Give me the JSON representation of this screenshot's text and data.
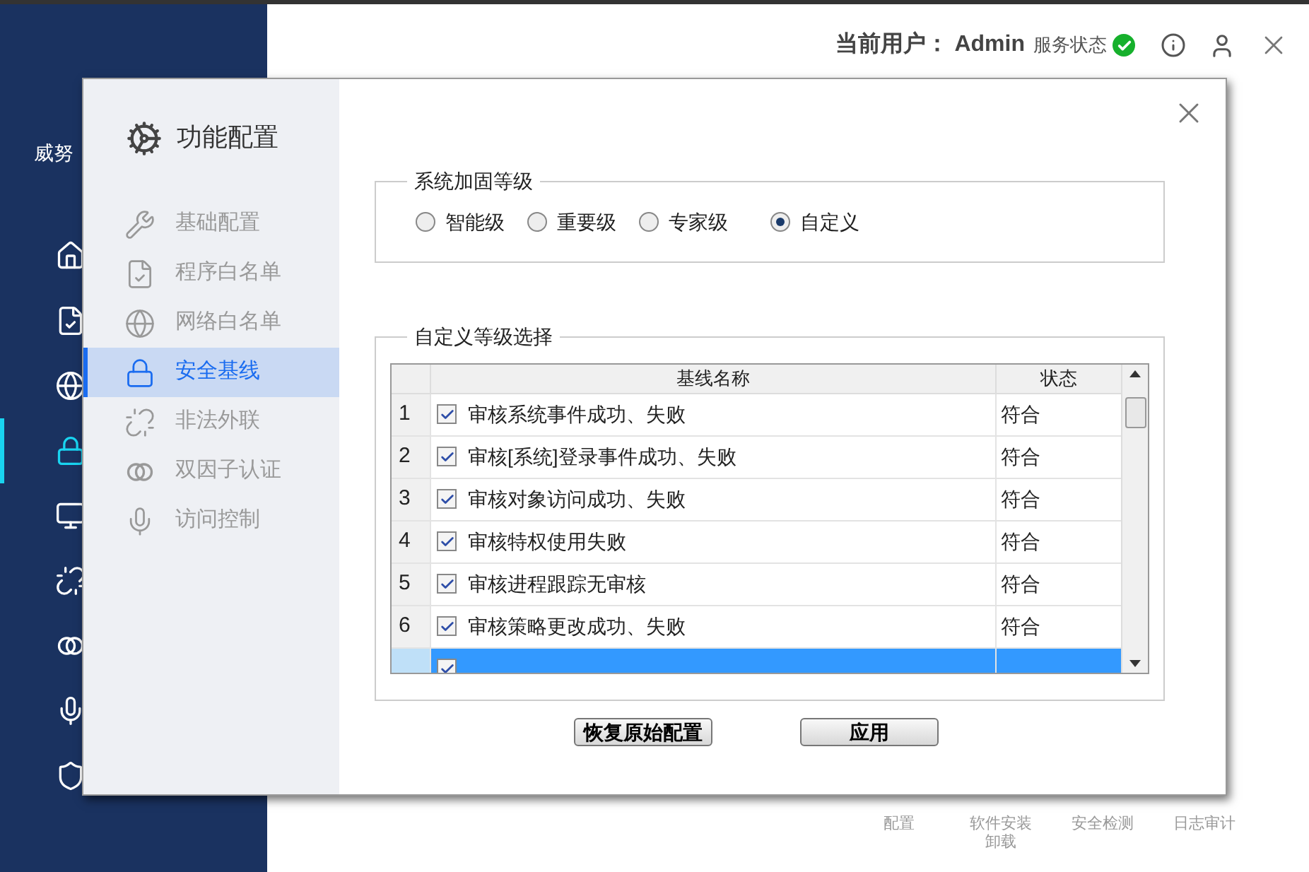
{
  "app": {
    "brand": "威努",
    "sidebar": [
      {
        "selected": false
      },
      {
        "selected": false
      },
      {
        "selected": false
      },
      {
        "selected": true
      },
      {
        "selected": false
      },
      {
        "selected": false
      },
      {
        "selected": false
      },
      {
        "selected": false
      },
      {
        "selected": false
      }
    ],
    "header": {
      "user_label": "当前用户：",
      "user": "Admin",
      "service_label": "服务状态",
      "service_ok": true
    },
    "bottom_tools": [
      [
        "配置"
      ],
      [
        "软件安装",
        "卸载"
      ],
      [
        "安全检测"
      ],
      [
        "日志审计"
      ]
    ]
  },
  "dialog": {
    "title": "功能配置",
    "nav": [
      {
        "label": "基础配置",
        "selected": false
      },
      {
        "label": "程序白名单",
        "selected": false
      },
      {
        "label": "网络白名单",
        "selected": false
      },
      {
        "label": "安全基线",
        "selected": true
      },
      {
        "label": "非法外联",
        "selected": false
      },
      {
        "label": "双因子认证",
        "selected": false
      },
      {
        "label": "访问控制",
        "selected": false
      }
    ],
    "level_group": {
      "legend": "系统加固等级",
      "options": [
        {
          "label": "智能级",
          "selected": false
        },
        {
          "label": "重要级",
          "selected": false
        },
        {
          "label": "专家级",
          "selected": false
        },
        {
          "label": "自定义",
          "selected": true
        }
      ]
    },
    "custom_group": {
      "legend": "自定义等级选择",
      "table": {
        "columns": [
          "基线名称",
          "状态"
        ],
        "rows": [
          {
            "index": "1",
            "name": "审核系统事件成功、失败",
            "status": "符合",
            "checked": true,
            "selected": false
          },
          {
            "index": "2",
            "name": "审核[系统]登录事件成功、失败",
            "status": "符合",
            "checked": true,
            "selected": false
          },
          {
            "index": "3",
            "name": "审核对象访问成功、失败",
            "status": "符合",
            "checked": true,
            "selected": false
          },
          {
            "index": "4",
            "name": "审核特权使用失败",
            "status": "符合",
            "checked": true,
            "selected": false
          },
          {
            "index": "5",
            "name": "审核进程跟踪无审核",
            "status": "符合",
            "checked": true,
            "selected": false
          },
          {
            "index": "6",
            "name": "审核策略更改成功、失败",
            "status": "符合",
            "checked": true,
            "selected": false
          },
          {
            "checked": true,
            "selected": true
          }
        ]
      }
    },
    "buttons": [
      "恢复原始配置",
      "应用"
    ]
  }
}
